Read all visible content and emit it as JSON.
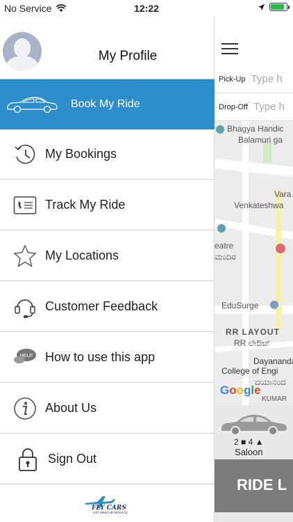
{
  "status_bar": {
    "carrier": "No Service",
    "time": "12:22"
  },
  "drawer": {
    "profile_title": "My Profile",
    "items": [
      {
        "label": "Book My Ride",
        "icon": "car-icon",
        "active": true
      },
      {
        "label": "My Bookings",
        "icon": "history-clock-icon"
      },
      {
        "label": "Track My Ride",
        "icon": "phone-card-icon"
      },
      {
        "label": "My Locations",
        "icon": "star-icon"
      },
      {
        "label": "Customer Feedback",
        "icon": "headset-icon"
      },
      {
        "label": "How to use this app",
        "icon": "help-chat-icon"
      },
      {
        "label": "About Us",
        "icon": "info-icon"
      },
      {
        "label": "Sign Out",
        "icon": "lock-icon"
      }
    ],
    "footer_logo": {
      "name": "FLY CARS",
      "tagline": "24/7 MINICAB SERVICE"
    }
  },
  "main": {
    "pickup_label": "Pick-Up",
    "pickup_placeholder": "Type h",
    "dropoff_label": "Drop-Off",
    "dropoff_placeholder": "Type h",
    "map_labels": {
      "l1": "Bhagya Handic",
      "l2": "Balamuri ga",
      "l3": "Vara",
      "l4": "Venkateshwa",
      "l5": "eatre",
      "l6": "ಮಂದಿರ",
      "l7": "EduSurge",
      "l8": "RR LAYOUT",
      "l9": "RR ಲೇಔಟ್",
      "l10": "Dayananda",
      "l11": "College of Engi",
      "l12": "ದಯಾನಂದ",
      "l13": "KUMAR"
    },
    "map_logo": "Google",
    "cab": {
      "bags": "2",
      "seats": "4",
      "type": "Saloon"
    },
    "ride_button": "RIDE L"
  },
  "colors": {
    "accent": "#2e8ecb",
    "battery": "#2bb84a"
  }
}
